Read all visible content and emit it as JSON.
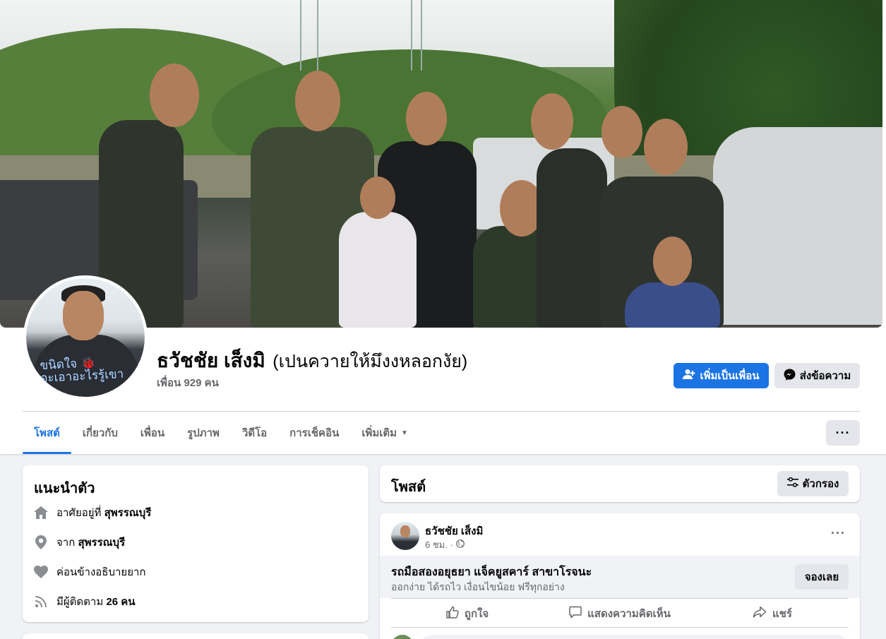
{
  "profile": {
    "name": "ธวัชชัย เส็งมิ",
    "alt_name": "(เปนควายให้มึงงหลอกงัย)",
    "friends": "เพื่อน 929 คน",
    "avatar_text": "ขนิดใจ 🐞\nจะเอาอะไรรู้เขา"
  },
  "actions": {
    "add_friend": "เพิ่มเป็นเพื่อน",
    "message": "ส่งข้อความ"
  },
  "tabs": [
    {
      "label": "โพสต์"
    },
    {
      "label": "เกี่ยวกับ"
    },
    {
      "label": "เพื่อน"
    },
    {
      "label": "รูปภาพ"
    },
    {
      "label": "วิดีโอ"
    },
    {
      "label": "การเช็คอิน"
    },
    {
      "label": "เพิ่มเติม"
    }
  ],
  "more_button": "···",
  "intro": {
    "title": "แนะนำตัว",
    "lives_prefix": "อาศัยอยู่ที่",
    "lives_value": "สุพรรณบุรี",
    "from_prefix": "จาก",
    "from_value": "สุพรรณบุรี",
    "relationship": "ค่อนข้างอธิบายยาก",
    "followers_prefix": "มีผู้ติดตาม",
    "followers_value": "26 คน"
  },
  "posts": {
    "title": "โพสต์",
    "filter": "ตัวกรอง"
  },
  "post": {
    "author": "ธวัชชัย เส็งมิ",
    "time": "6 ชม. ·",
    "dots": "···",
    "ad_title": "รถมือสองอยุธยา แจ็คยูสคาร์ สาขาโรจนะ",
    "ad_subtitle": "ออกง่าย ได้รถไว เงื่อนไขน้อย ฟรีทุกอย่าง",
    "ad_button": "จองเลย",
    "like": "ถูกใจ",
    "comment": "แสดงความคิดเห็น",
    "share": "แชร์"
  },
  "colors": {
    "accent": "#1b74e4",
    "background": "#f0f2f5",
    "secondary_text": "#65676b"
  }
}
